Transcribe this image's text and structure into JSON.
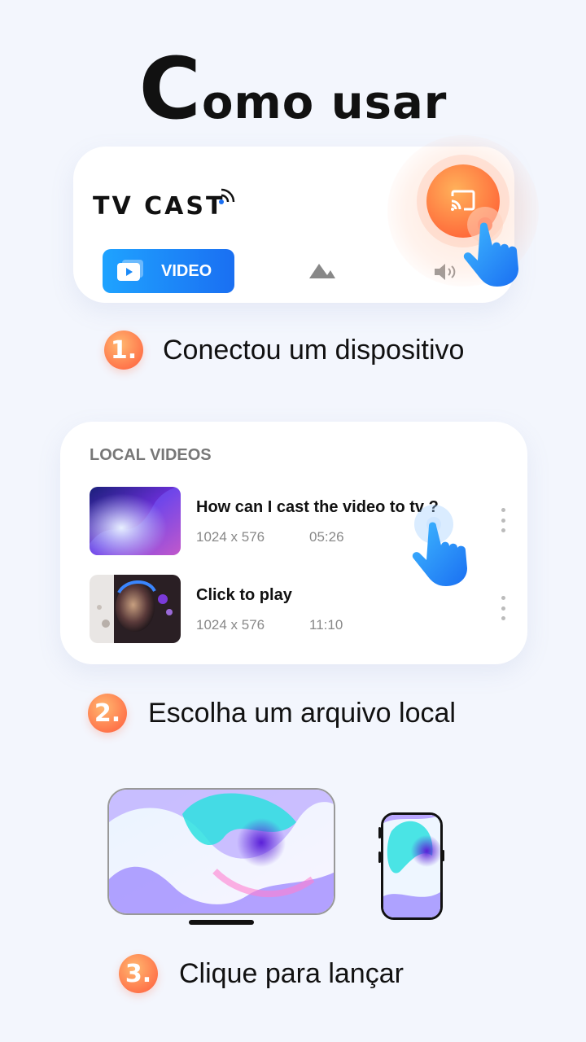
{
  "title": {
    "first_letter": "C",
    "rest": "omo usar"
  },
  "card1": {
    "brand": "TV CAST",
    "video_tab_label": "VIDEO",
    "image_tab_icon": "image-icon",
    "audio_tab_icon": "volume-icon",
    "cast_button_icon": "cast-icon"
  },
  "steps": [
    {
      "number": "1.",
      "text": "Conectou um dispositivo"
    },
    {
      "number": "2.",
      "text": "Escolha um arquivo local"
    },
    {
      "number": "3.",
      "text": "Clique para lançar"
    }
  ],
  "local_videos": {
    "header": "LOCAL VIDEOS",
    "items": [
      {
        "name": "How can I cast the video to tv ?",
        "resolution": "1024 x 576",
        "duration": "05:26"
      },
      {
        "name": "Click to play",
        "resolution": "1024 x 576",
        "duration": "11:10"
      }
    ]
  },
  "colors": {
    "accent_orange": "#ff6d46",
    "accent_blue": "#1a6ff2",
    "background": "#f3f6fd"
  }
}
